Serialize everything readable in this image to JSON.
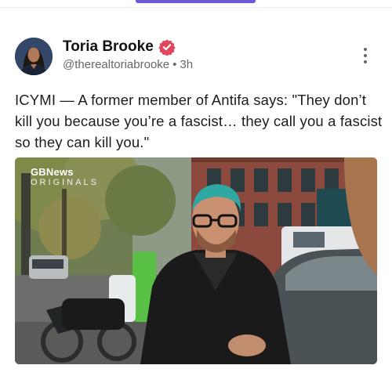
{
  "header": {
    "active_tab_indicator": "#6a5ad8"
  },
  "post": {
    "author_name": "Toria Brooke",
    "handle": "@therealtoriabrooke",
    "separator": "•",
    "timestamp": "3h",
    "verified_color": "#e0465e",
    "text": "ICYMI — A former member of Antifa says: \"They don’t kill you because you’re a fascist… they call you a fascist so they can kill you.\"",
    "media": {
      "logo_brand": "GBNews",
      "logo_sub": "ORIGINALS"
    }
  },
  "icons": {
    "avatar": "profile-photo",
    "verified": "verified-badge-icon",
    "more": "more-vertical-icon"
  }
}
